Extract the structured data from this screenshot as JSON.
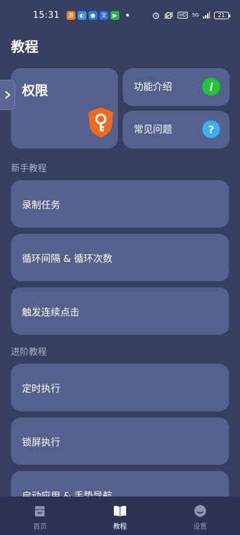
{
  "status_bar": {
    "time": "15:31",
    "battery": "21",
    "network": "5G",
    "hd": "HD",
    "app_icons": [
      {
        "name": "game-app-icon",
        "glyph": "游",
        "color": "#e87a2c"
      },
      {
        "name": "app-icon-2",
        "glyph": "◐",
        "color": "#3a8ee6"
      },
      {
        "name": "app-icon-3",
        "glyph": "●",
        "color": "#2a7fd6"
      },
      {
        "name": "translate-app-icon",
        "glyph": "文",
        "color": "#2d6be0"
      },
      {
        "name": "play-app-icon",
        "glyph": "▶",
        "color": "#28b34b"
      }
    ]
  },
  "header": {
    "title": "教程"
  },
  "cards": {
    "permissions": {
      "label": "权限"
    },
    "features": {
      "label": "功能介绍",
      "icon": "info-icon",
      "icon_glyph": "i",
      "icon_color": "#21c53a"
    },
    "faq": {
      "label": "常见问题",
      "icon": "question-icon",
      "icon_glyph": "?",
      "icon_color": "#3aaef0"
    }
  },
  "sections": {
    "beginner": {
      "title": "新手教程",
      "items": [
        "录制任务",
        "循环间隔 & 循环次数",
        "触发连续点击"
      ]
    },
    "advanced": {
      "title": "进阶教程",
      "items": [
        "定时执行",
        "锁屏执行",
        "启动应用 & 手势导航"
      ]
    }
  },
  "bottom_nav": {
    "items": [
      {
        "label": "首页",
        "icon": "home-icon",
        "active": false
      },
      {
        "label": "教程",
        "icon": "book-icon",
        "active": true
      },
      {
        "label": "设置",
        "icon": "settings-face-icon",
        "active": false
      }
    ]
  },
  "colors": {
    "background": "#363f60",
    "card": "#54618d",
    "shield": "#f06a1f",
    "nav_background": "#2b3350"
  }
}
